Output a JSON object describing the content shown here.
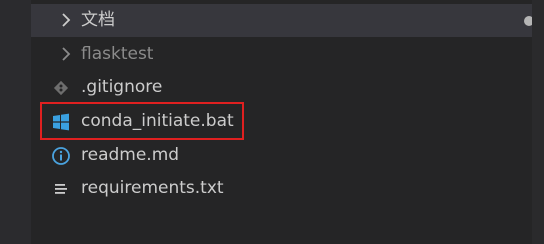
{
  "explorer": {
    "items": [
      {
        "label": "文档",
        "icon": "chevron-right-icon",
        "type": "folder",
        "modified_dot": true
      },
      {
        "label": "flasktest",
        "icon": "chevron-right-icon",
        "type": "folder"
      },
      {
        "label": ".gitignore",
        "icon": "git-diamond-icon",
        "type": "file"
      },
      {
        "label": "conda_initiate.bat",
        "icon": "windows-logo-icon",
        "type": "file",
        "highlighted": true
      },
      {
        "label": "readme.md",
        "icon": "info-circle-icon",
        "type": "file"
      },
      {
        "label": "requirements.txt",
        "icon": "text-lines-icon",
        "type": "file"
      }
    ]
  },
  "colors": {
    "background": "#252526",
    "selected_row": "#37373d",
    "text": "#cccccc",
    "dim_text": "#8b8b8b",
    "highlight_border": "#e02020",
    "windows_icon": "#3aa0e0",
    "info_icon": "#4aa3df"
  }
}
